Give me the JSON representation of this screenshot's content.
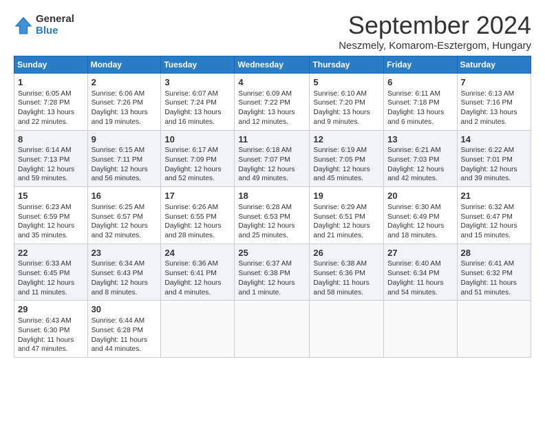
{
  "logo": {
    "general": "General",
    "blue": "Blue"
  },
  "header": {
    "title": "September 2024",
    "subtitle": "Neszmely, Komarom-Esztergom, Hungary"
  },
  "days": [
    "Sunday",
    "Monday",
    "Tuesday",
    "Wednesday",
    "Thursday",
    "Friday",
    "Saturday"
  ],
  "weeks": [
    [
      {
        "day": "1",
        "sunrise": "Sunrise: 6:05 AM",
        "sunset": "Sunset: 7:28 PM",
        "daylight": "Daylight: 13 hours and 22 minutes."
      },
      {
        "day": "2",
        "sunrise": "Sunrise: 6:06 AM",
        "sunset": "Sunset: 7:26 PM",
        "daylight": "Daylight: 13 hours and 19 minutes."
      },
      {
        "day": "3",
        "sunrise": "Sunrise: 6:07 AM",
        "sunset": "Sunset: 7:24 PM",
        "daylight": "Daylight: 13 hours and 16 minutes."
      },
      {
        "day": "4",
        "sunrise": "Sunrise: 6:09 AM",
        "sunset": "Sunset: 7:22 PM",
        "daylight": "Daylight: 13 hours and 12 minutes."
      },
      {
        "day": "5",
        "sunrise": "Sunrise: 6:10 AM",
        "sunset": "Sunset: 7:20 PM",
        "daylight": "Daylight: 13 hours and 9 minutes."
      },
      {
        "day": "6",
        "sunrise": "Sunrise: 6:11 AM",
        "sunset": "Sunset: 7:18 PM",
        "daylight": "Daylight: 13 hours and 6 minutes."
      },
      {
        "day": "7",
        "sunrise": "Sunrise: 6:13 AM",
        "sunset": "Sunset: 7:16 PM",
        "daylight": "Daylight: 13 hours and 2 minutes."
      }
    ],
    [
      {
        "day": "8",
        "sunrise": "Sunrise: 6:14 AM",
        "sunset": "Sunset: 7:13 PM",
        "daylight": "Daylight: 12 hours and 59 minutes."
      },
      {
        "day": "9",
        "sunrise": "Sunrise: 6:15 AM",
        "sunset": "Sunset: 7:11 PM",
        "daylight": "Daylight: 12 hours and 56 minutes."
      },
      {
        "day": "10",
        "sunrise": "Sunrise: 6:17 AM",
        "sunset": "Sunset: 7:09 PM",
        "daylight": "Daylight: 12 hours and 52 minutes."
      },
      {
        "day": "11",
        "sunrise": "Sunrise: 6:18 AM",
        "sunset": "Sunset: 7:07 PM",
        "daylight": "Daylight: 12 hours and 49 minutes."
      },
      {
        "day": "12",
        "sunrise": "Sunrise: 6:19 AM",
        "sunset": "Sunset: 7:05 PM",
        "daylight": "Daylight: 12 hours and 45 minutes."
      },
      {
        "day": "13",
        "sunrise": "Sunrise: 6:21 AM",
        "sunset": "Sunset: 7:03 PM",
        "daylight": "Daylight: 12 hours and 42 minutes."
      },
      {
        "day": "14",
        "sunrise": "Sunrise: 6:22 AM",
        "sunset": "Sunset: 7:01 PM",
        "daylight": "Daylight: 12 hours and 39 minutes."
      }
    ],
    [
      {
        "day": "15",
        "sunrise": "Sunrise: 6:23 AM",
        "sunset": "Sunset: 6:59 PM",
        "daylight": "Daylight: 12 hours and 35 minutes."
      },
      {
        "day": "16",
        "sunrise": "Sunrise: 6:25 AM",
        "sunset": "Sunset: 6:57 PM",
        "daylight": "Daylight: 12 hours and 32 minutes."
      },
      {
        "day": "17",
        "sunrise": "Sunrise: 6:26 AM",
        "sunset": "Sunset: 6:55 PM",
        "daylight": "Daylight: 12 hours and 28 minutes."
      },
      {
        "day": "18",
        "sunrise": "Sunrise: 6:28 AM",
        "sunset": "Sunset: 6:53 PM",
        "daylight": "Daylight: 12 hours and 25 minutes."
      },
      {
        "day": "19",
        "sunrise": "Sunrise: 6:29 AM",
        "sunset": "Sunset: 6:51 PM",
        "daylight": "Daylight: 12 hours and 21 minutes."
      },
      {
        "day": "20",
        "sunrise": "Sunrise: 6:30 AM",
        "sunset": "Sunset: 6:49 PM",
        "daylight": "Daylight: 12 hours and 18 minutes."
      },
      {
        "day": "21",
        "sunrise": "Sunrise: 6:32 AM",
        "sunset": "Sunset: 6:47 PM",
        "daylight": "Daylight: 12 hours and 15 minutes."
      }
    ],
    [
      {
        "day": "22",
        "sunrise": "Sunrise: 6:33 AM",
        "sunset": "Sunset: 6:45 PM",
        "daylight": "Daylight: 12 hours and 11 minutes."
      },
      {
        "day": "23",
        "sunrise": "Sunrise: 6:34 AM",
        "sunset": "Sunset: 6:43 PM",
        "daylight": "Daylight: 12 hours and 8 minutes."
      },
      {
        "day": "24",
        "sunrise": "Sunrise: 6:36 AM",
        "sunset": "Sunset: 6:41 PM",
        "daylight": "Daylight: 12 hours and 4 minutes."
      },
      {
        "day": "25",
        "sunrise": "Sunrise: 6:37 AM",
        "sunset": "Sunset: 6:38 PM",
        "daylight": "Daylight: 12 hours and 1 minute."
      },
      {
        "day": "26",
        "sunrise": "Sunrise: 6:38 AM",
        "sunset": "Sunset: 6:36 PM",
        "daylight": "Daylight: 11 hours and 58 minutes."
      },
      {
        "day": "27",
        "sunrise": "Sunrise: 6:40 AM",
        "sunset": "Sunset: 6:34 PM",
        "daylight": "Daylight: 11 hours and 54 minutes."
      },
      {
        "day": "28",
        "sunrise": "Sunrise: 6:41 AM",
        "sunset": "Sunset: 6:32 PM",
        "daylight": "Daylight: 11 hours and 51 minutes."
      }
    ],
    [
      {
        "day": "29",
        "sunrise": "Sunrise: 6:43 AM",
        "sunset": "Sunset: 6:30 PM",
        "daylight": "Daylight: 11 hours and 47 minutes."
      },
      {
        "day": "30",
        "sunrise": "Sunrise: 6:44 AM",
        "sunset": "Sunset: 6:28 PM",
        "daylight": "Daylight: 11 hours and 44 minutes."
      },
      null,
      null,
      null,
      null,
      null
    ]
  ]
}
